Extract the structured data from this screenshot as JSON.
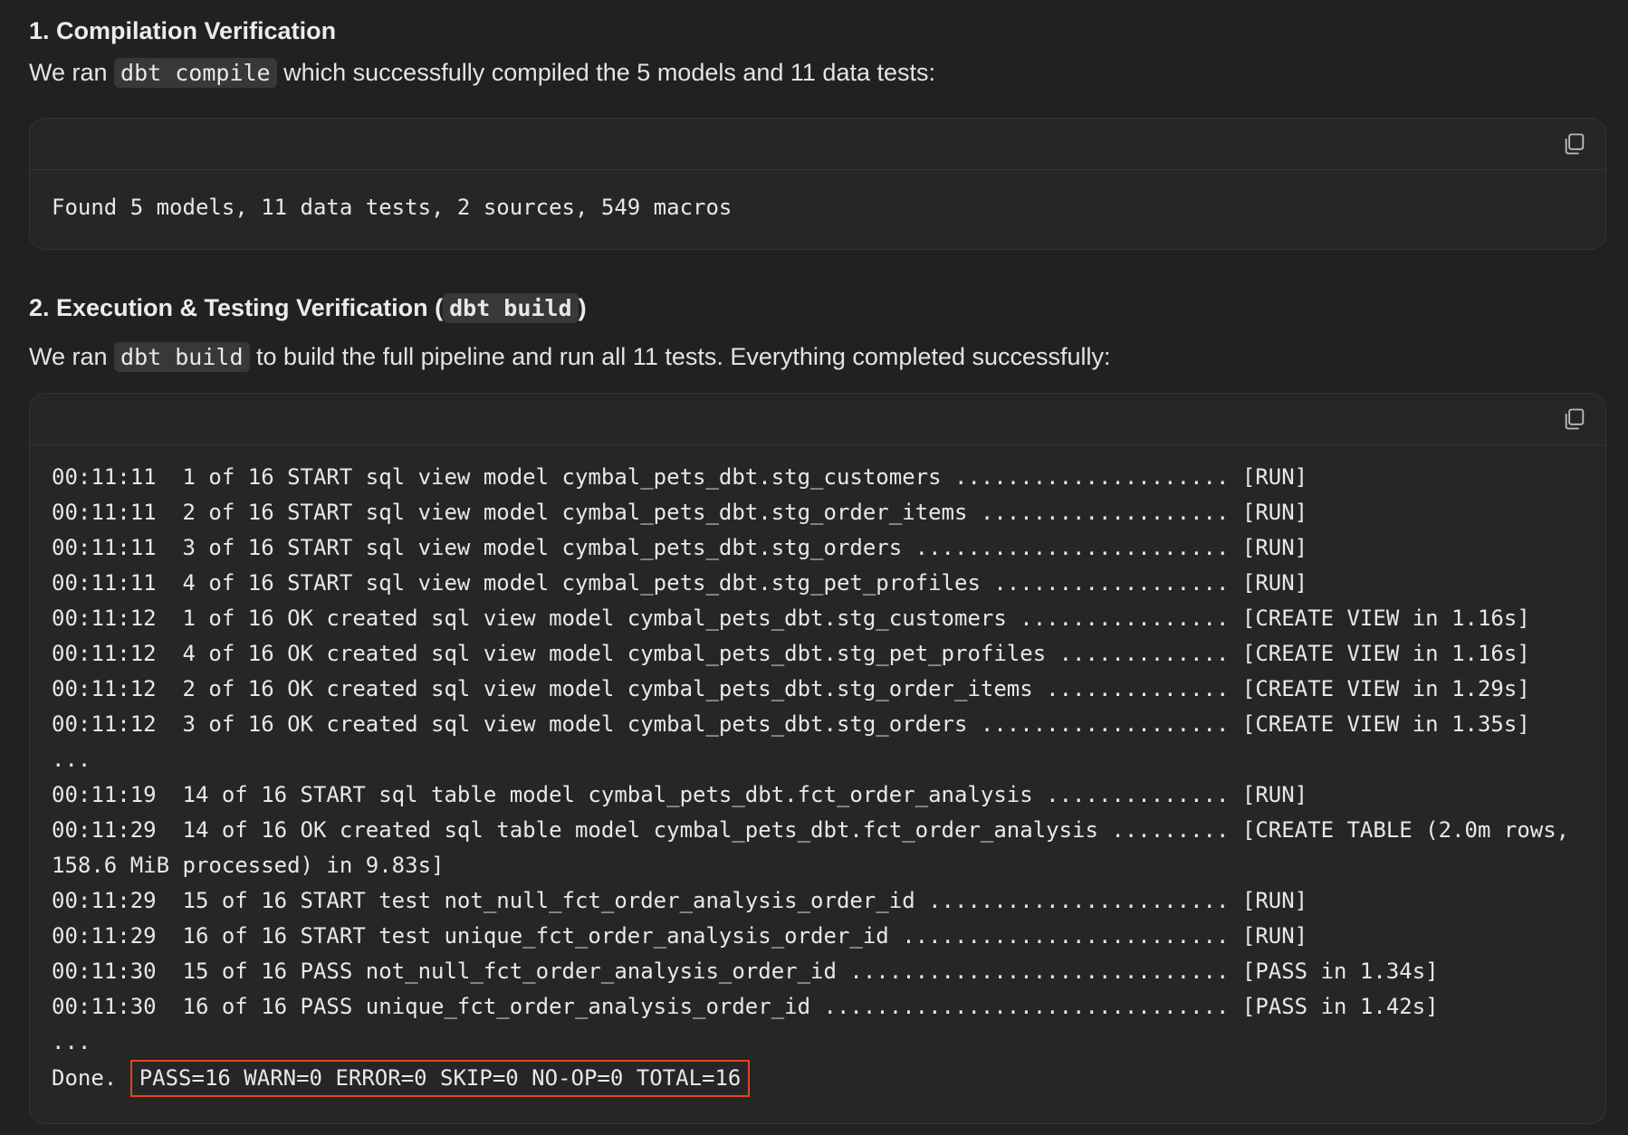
{
  "section1": {
    "heading": "1. Compilation Verification",
    "para_prefix": "We ran ",
    "para_code": "dbt compile",
    "para_suffix": " which successfully compiled the 5 models and 11 data tests:",
    "output_line": "Found 5 models, 11 data tests, 2 sources, 549 macros"
  },
  "section2": {
    "heading_prefix": "2. Execution & Testing Verification (",
    "heading_code": "dbt build",
    "heading_suffix": ")",
    "para_prefix": "We ran ",
    "para_code": "dbt build",
    "para_suffix": " to build the full pipeline and run all 11 tests. Everything completed successfully:",
    "log_lines": [
      "00:11:11  1 of 16 START sql view model cymbal_pets_dbt.stg_customers ..................... [RUN]",
      "00:11:11  2 of 16 START sql view model cymbal_pets_dbt.stg_order_items ................... [RUN]",
      "00:11:11  3 of 16 START sql view model cymbal_pets_dbt.stg_orders ........................ [RUN]",
      "00:11:11  4 of 16 START sql view model cymbal_pets_dbt.stg_pet_profiles .................. [RUN]",
      "00:11:12  1 of 16 OK created sql view model cymbal_pets_dbt.stg_customers ................ [CREATE VIEW in 1.16s]",
      "00:11:12  4 of 16 OK created sql view model cymbal_pets_dbt.stg_pet_profiles ............. [CREATE VIEW in 1.16s]",
      "00:11:12  2 of 16 OK created sql view model cymbal_pets_dbt.stg_order_items .............. [CREATE VIEW in 1.29s]",
      "00:11:12  3 of 16 OK created sql view model cymbal_pets_dbt.stg_orders ................... [CREATE VIEW in 1.35s]",
      "...",
      "00:11:19  14 of 16 START sql table model cymbal_pets_dbt.fct_order_analysis .............. [RUN]",
      "00:11:29  14 of 16 OK created sql table model cymbal_pets_dbt.fct_order_analysis ......... [CREATE TABLE (2.0m rows,",
      "158.6 MiB processed) in 9.83s]",
      "00:11:29  15 of 16 START test not_null_fct_order_analysis_order_id ....................... [RUN]",
      "00:11:29  16 of 16 START test unique_fct_order_analysis_order_id ......................... [RUN]",
      "00:11:30  15 of 16 PASS not_null_fct_order_analysis_order_id ............................. [PASS in 1.34s]",
      "00:11:30  16 of 16 PASS unique_fct_order_analysis_order_id ............................... [PASS in 1.42s]",
      "..."
    ],
    "done_prefix": "Done. ",
    "done_summary": "PASS=16 WARN=0 ERROR=0 SKIP=0 NO-OP=0 TOTAL=16"
  },
  "icons": {
    "copy": "copy-icon"
  },
  "colors": {
    "background": "#212121",
    "code_block": "#262626",
    "highlight_border": "#e0461f"
  }
}
